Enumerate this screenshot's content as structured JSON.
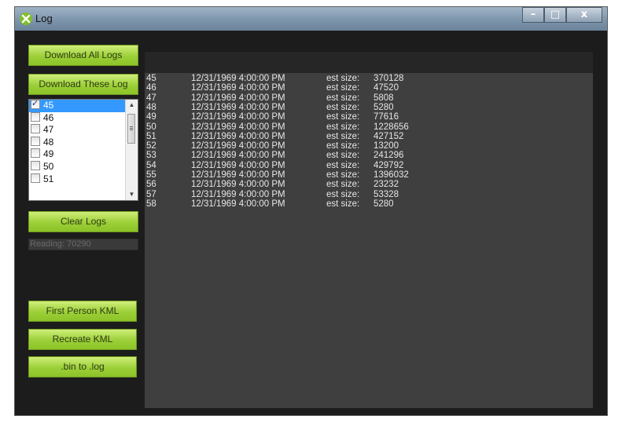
{
  "window": {
    "title": "Log"
  },
  "buttons": {
    "download_all": "Download All Logs",
    "download_these": "Download These Log",
    "clear_logs": "Clear Logs",
    "first_person_kml": "First Person KML",
    "recreate_kml": "Recreate KML",
    "bin_to_log": ".bin to .log"
  },
  "progress": {
    "text": "Reading: 70290"
  },
  "log_list": {
    "items": [
      {
        "label": "45",
        "checked": true,
        "selected": true
      },
      {
        "label": "46",
        "checked": false,
        "selected": false
      },
      {
        "label": "47",
        "checked": false,
        "selected": false
      },
      {
        "label": "48",
        "checked": false,
        "selected": false
      },
      {
        "label": "49",
        "checked": false,
        "selected": false
      },
      {
        "label": "50",
        "checked": false,
        "selected": false
      },
      {
        "label": "51",
        "checked": false,
        "selected": false
      }
    ]
  },
  "log_rows": [
    {
      "id": "45",
      "date": "12/31/1969 4:00:00 PM",
      "est_label": "est size:",
      "size": "370128"
    },
    {
      "id": "46",
      "date": "12/31/1969 4:00:00 PM",
      "est_label": "est size:",
      "size": "47520"
    },
    {
      "id": "47",
      "date": "12/31/1969 4:00:00 PM",
      "est_label": "est size:",
      "size": "5808"
    },
    {
      "id": "48",
      "date": "12/31/1969 4:00:00 PM",
      "est_label": "est size:",
      "size": "5280"
    },
    {
      "id": "49",
      "date": "12/31/1969 4:00:00 PM",
      "est_label": "est size:",
      "size": "77616"
    },
    {
      "id": "50",
      "date": "12/31/1969 4:00:00 PM",
      "est_label": "est size:",
      "size": "1228656"
    },
    {
      "id": "51",
      "date": "12/31/1969 4:00:00 PM",
      "est_label": "est size:",
      "size": "427152"
    },
    {
      "id": "52",
      "date": "12/31/1969 4:00:00 PM",
      "est_label": "est size:",
      "size": "13200"
    },
    {
      "id": "53",
      "date": "12/31/1969 4:00:00 PM",
      "est_label": "est size:",
      "size": "241296"
    },
    {
      "id": "54",
      "date": "12/31/1969 4:00:00 PM",
      "est_label": "est size:",
      "size": "429792"
    },
    {
      "id": "55",
      "date": "12/31/1969 4:00:00 PM",
      "est_label": "est size:",
      "size": "1396032"
    },
    {
      "id": "56",
      "date": "12/31/1969 4:00:00 PM",
      "est_label": "est size:",
      "size": "23232"
    },
    {
      "id": "57",
      "date": "12/31/1969 4:00:00 PM",
      "est_label": "est size:",
      "size": "53328"
    },
    {
      "id": "58",
      "date": "12/31/1969 4:00:00 PM",
      "est_label": "est size:",
      "size": "5280"
    }
  ],
  "colors": {
    "accent": "#9ccf38",
    "background": "#1c1c1c",
    "log_panel": "#3f3f3f",
    "selection": "#3399ff"
  },
  "icons": {
    "app": "app-logo-icon",
    "minimize": "minimize-icon",
    "maximize": "maximize-icon",
    "close": "close-icon"
  }
}
